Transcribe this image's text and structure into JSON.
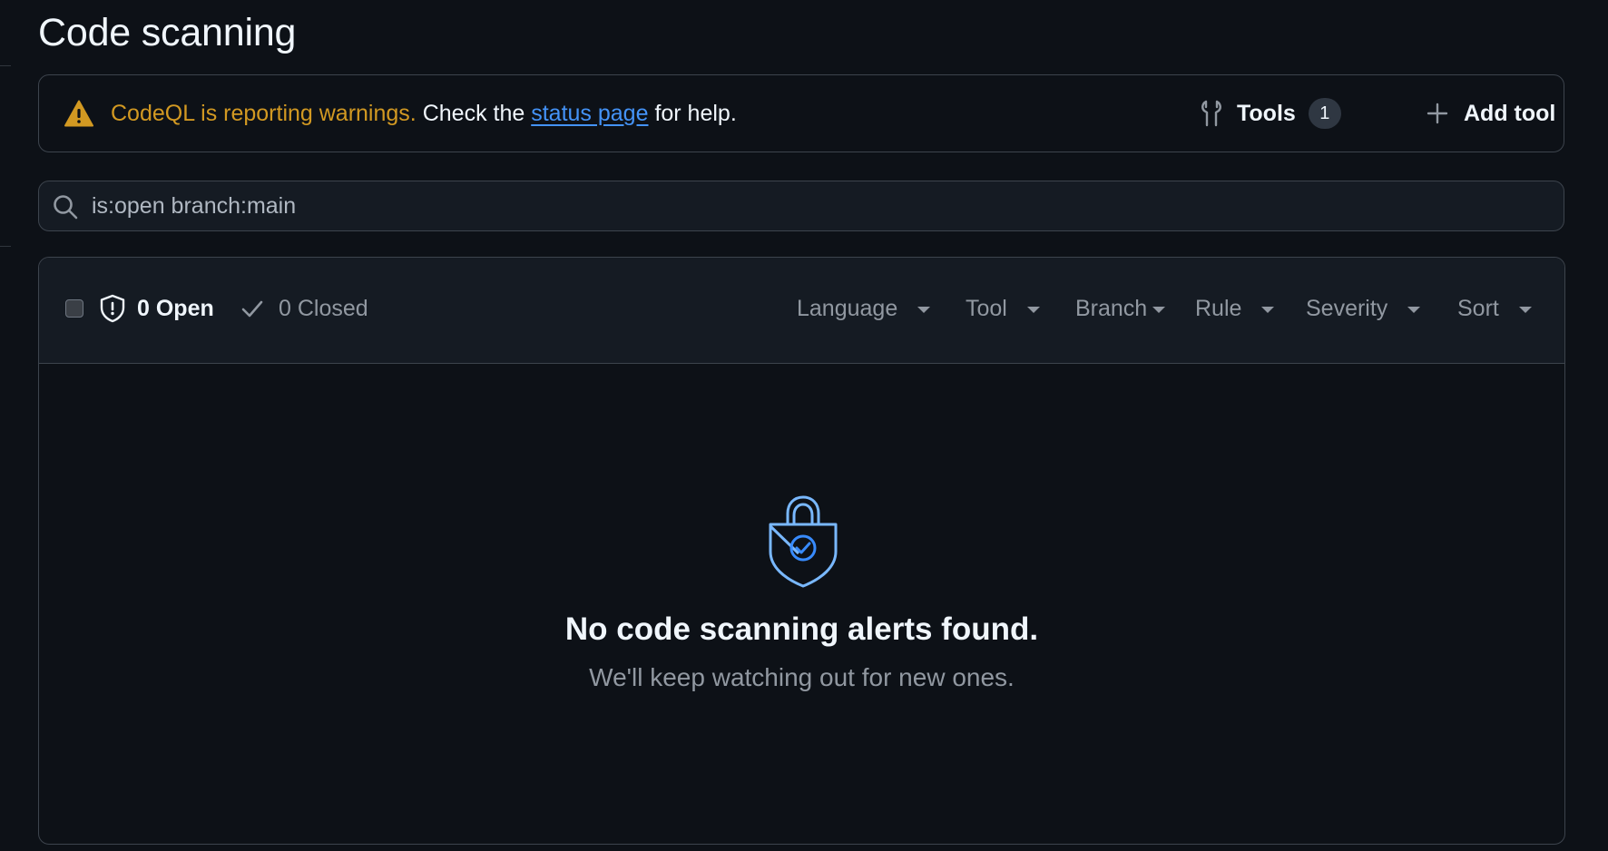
{
  "page": {
    "title": "Code scanning"
  },
  "banner": {
    "warning_text": "CodeQL is reporting warnings.",
    "check_text": "Check the",
    "link_text": "status page",
    "after_link_text": "for help.",
    "tools_label": "Tools",
    "tools_count": "1",
    "add_tool_label": "Add tool",
    "icons": [
      "alert-icon",
      "tools-icon",
      "plus-icon"
    ]
  },
  "search": {
    "value": "is:open branch:main"
  },
  "alerts": {
    "open_label": "0 Open",
    "closed_label": "0 Closed",
    "filters": [
      {
        "label": "Language"
      },
      {
        "label": "Tool"
      },
      {
        "label": "Branch"
      },
      {
        "label": "Rule"
      },
      {
        "label": "Severity"
      },
      {
        "label": "Sort"
      }
    ]
  },
  "empty_state": {
    "title": "No code scanning alerts found.",
    "subtitle": "We'll keep watching out for new ones."
  },
  "colors": {
    "background": "#0d1117",
    "warning": "#d29922",
    "link": "#4493f8",
    "muted": "#9198a1",
    "border": "#3d444d"
  }
}
